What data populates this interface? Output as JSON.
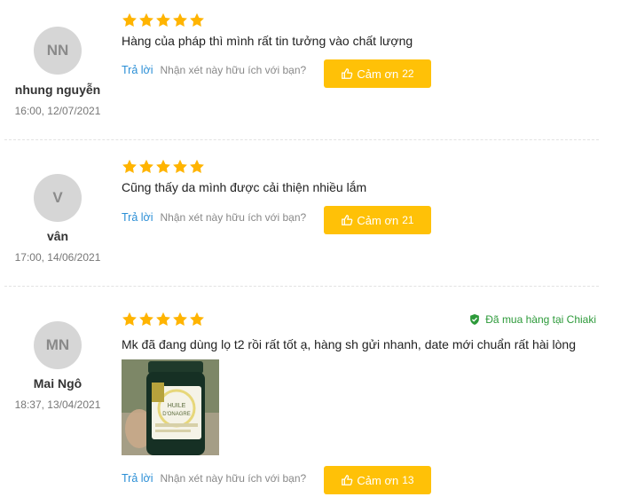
{
  "reviews": [
    {
      "initials": "NN",
      "name": "nhung nguyễn",
      "date": "16:00, 12/07/2021",
      "comment": "Hàng của pháp thì mình rất tin tưởng vào chất lượng",
      "reply": "Trả lời",
      "helpful": "Nhận xét này hữu ích với bạn?",
      "thanks_label": "Cảm ơn",
      "thanks_count": "22",
      "rating": 5
    },
    {
      "initials": "V",
      "name": "vân",
      "date": "17:00, 14/06/2021",
      "comment": "Cũng thấy da mình được cải thiện nhiều lắm",
      "reply": "Trả lời",
      "helpful": "Nhận xét này hữu ích với bạn?",
      "thanks_label": "Cảm ơn",
      "thanks_count": "21",
      "rating": 5
    },
    {
      "initials": "MN",
      "name": "Mai Ngô",
      "date": "18:37, 13/04/2021",
      "comment": "Mk đã đang dùng lọ t2 rồi rất tốt ạ, hàng sh gửi nhanh, date mới chuẩn rất hài lòng",
      "badge": "Đã mua hàng tại Chiaki",
      "reply": "Trả lời",
      "helpful": "Nhận xét này hữu ích với bạn?",
      "thanks_label": "Cảm ơn",
      "thanks_count": "13",
      "rating": 5,
      "photo_text": [
        "HUILE",
        "D'ONAGRE"
      ]
    }
  ],
  "colors": {
    "star": "#ffb400",
    "button": "#ffc107",
    "link": "#2b8fd6",
    "badge": "#2d9a3a"
  }
}
